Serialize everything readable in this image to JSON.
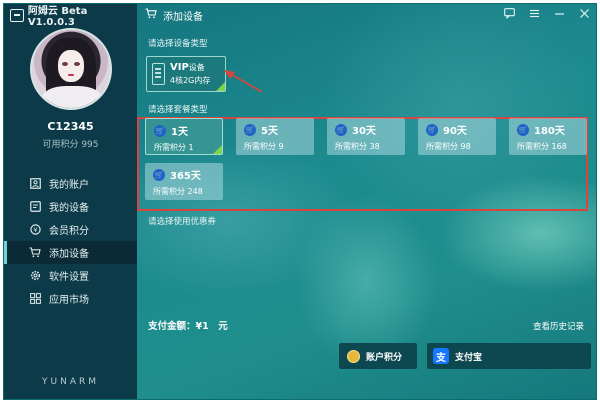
{
  "app": {
    "title": "阿姆云 Beta V1.0.0.3",
    "brand_footer": "YUNARM"
  },
  "user": {
    "name": "C12345",
    "points_label": "可用积分 995"
  },
  "sidebar": {
    "items": [
      {
        "label": "我的账户",
        "icon": "account-icon"
      },
      {
        "label": "我的设备",
        "icon": "device-icon"
      },
      {
        "label": "会员积分",
        "icon": "points-icon"
      },
      {
        "label": "添加设备",
        "icon": "cart-icon",
        "active": true
      },
      {
        "label": "软件设置",
        "icon": "gear-icon"
      },
      {
        "label": "应用市场",
        "icon": "grid-icon"
      }
    ]
  },
  "header": {
    "title": "添加设备",
    "controls": [
      "chat-icon",
      "menu-icon",
      "minimize-icon",
      "close-icon"
    ]
  },
  "main": {
    "device_type_label": "请选择设备类型",
    "device": {
      "name": "VIP",
      "name_suffix": "设备",
      "spec": "4核2G内存"
    },
    "plan_type_label": "请选择套餐类型",
    "plans": [
      {
        "days": "1天",
        "cost": "所需积分 1",
        "selected": true
      },
      {
        "days": "5天",
        "cost": "所需积分 9"
      },
      {
        "days": "30天",
        "cost": "所需积分 38"
      },
      {
        "days": "90天",
        "cost": "所需积分 98"
      },
      {
        "days": "180天",
        "cost": "所需积分 168"
      },
      {
        "days": "365天",
        "cost": "所需积分 248"
      }
    ],
    "coupon_label": "请选择使用优惠券",
    "pay_total": "支付金额：¥1　元",
    "history_link": "查看历史记录",
    "pay_points": "账户积分",
    "pay_alipay": "支付宝"
  },
  "colors": {
    "sidebar_bg": "#0c3a48",
    "main_bg": "#1c8b8f",
    "highlight": "#d9443d",
    "selected_corner": "#7dd54b",
    "alipay_blue": "#1677ff"
  }
}
